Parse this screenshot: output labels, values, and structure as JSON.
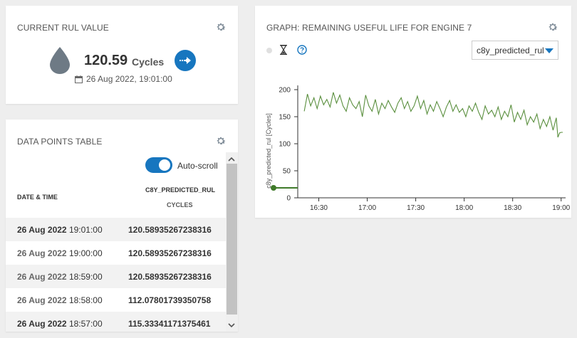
{
  "rul_card": {
    "title": "CURRENT RUL VALUE",
    "value": "120.59",
    "unit": "Cycles",
    "date": "26 Aug 2022, 19:01:00"
  },
  "table_card": {
    "title": "DATA POINTS TABLE",
    "autoscroll_label": "Auto-scroll",
    "autoscroll_on": true,
    "col_date": "DATE & TIME",
    "col_series": "C8Y_PREDICTED_RUL",
    "col_unit": "CYCLES",
    "rows": [
      {
        "day": "26 Aug 2022",
        "time": "19:01:00",
        "value": "120.58935267238316"
      },
      {
        "day": "26 Aug 2022",
        "time": "19:00:00",
        "value": "120.58935267238316"
      },
      {
        "day": "26 Aug 2022",
        "time": "18:59:00",
        "value": "120.58935267238316"
      },
      {
        "day": "26 Aug 2022",
        "time": "18:58:00",
        "value": "112.07801739350758"
      },
      {
        "day": "26 Aug 2022",
        "time": "18:57:00",
        "value": "115.33341171375461"
      }
    ]
  },
  "graph_card": {
    "title": "GRAPH: REMAINING USEFUL LIFE FOR ENGINE 7",
    "select_value": "c8y_predicted_rul"
  },
  "colors": {
    "accent": "#1776bf",
    "line": "#5a8f3e",
    "icon": "#7d8a96"
  },
  "chart_data": {
    "type": "line",
    "ylabel": "c8y_predicted_rul [Cycles]",
    "xlabel": "",
    "ylim": [
      0,
      200
    ],
    "yticks": [
      0,
      50,
      100,
      150,
      200
    ],
    "xticks": [
      "16:30",
      "17:00",
      "17:30",
      "18:00",
      "18:30",
      "19:00"
    ],
    "xlim": [
      "16:17",
      "19:01"
    ],
    "series": [
      {
        "times": [
          "16:21",
          "16:23",
          "16:25",
          "16:27",
          "16:29",
          "16:31",
          "16:33",
          "16:35",
          "16:37",
          "16:39",
          "16:41",
          "16:43",
          "16:45",
          "16:47",
          "16:49",
          "16:51",
          "16:53",
          "16:55",
          "16:57",
          "16:59",
          "17:01",
          "17:03",
          "17:05",
          "17:07",
          "17:09",
          "17:11",
          "17:13",
          "17:15",
          "17:17",
          "17:19",
          "17:21",
          "17:23",
          "17:25",
          "17:27",
          "17:29",
          "17:31",
          "17:33",
          "17:35",
          "17:37",
          "17:39",
          "17:41",
          "17:43",
          "17:45",
          "17:47",
          "17:49",
          "17:51",
          "17:53",
          "17:55",
          "17:57",
          "17:59",
          "18:01",
          "18:03",
          "18:05",
          "18:07",
          "18:09",
          "18:11",
          "18:13",
          "18:15",
          "18:17",
          "18:19",
          "18:21",
          "18:23",
          "18:25",
          "18:27",
          "18:29",
          "18:31",
          "18:33",
          "18:35",
          "18:37",
          "18:39",
          "18:41",
          "18:43",
          "18:45",
          "18:47",
          "18:49",
          "18:51",
          "18:53",
          "18:55",
          "18:57",
          "18:58",
          "18:59",
          "19:00",
          "19:01"
        ],
        "values": [
          160,
          192,
          170,
          185,
          165,
          188,
          172,
          182,
          168,
          195,
          175,
          190,
          170,
          160,
          185,
          172,
          165,
          178,
          150,
          190,
          170,
          160,
          182,
          155,
          175,
          165,
          180,
          168,
          158,
          175,
          185,
          165,
          178,
          160,
          170,
          188,
          165,
          180,
          155,
          172,
          160,
          178,
          165,
          150,
          168,
          180,
          160,
          172,
          158,
          165,
          150,
          170,
          160,
          175,
          158,
          145,
          170,
          155,
          162,
          150,
          168,
          145,
          160,
          150,
          172,
          140,
          158,
          145,
          162,
          135,
          150,
          140,
          155,
          128,
          145,
          132,
          150,
          125,
          148,
          112,
          120,
          121,
          121
        ]
      }
    ]
  }
}
